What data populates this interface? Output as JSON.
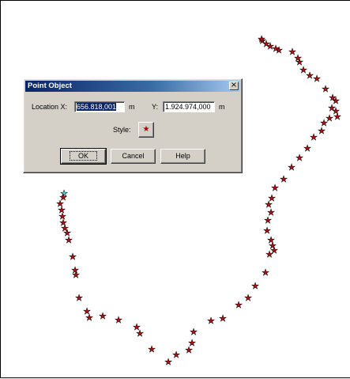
{
  "dialog": {
    "title": "Point Object",
    "close_glyph": "×",
    "location_x_label": "Location X:",
    "location_x_value": "656.818,001",
    "unit_m": "m",
    "y_label": "Y:",
    "y_value": "1.924.974,000",
    "style_label": "Style:",
    "style_icon": "star-symbol-icon",
    "buttons": {
      "ok": "OK",
      "cancel": "Cancel",
      "help": "Help"
    }
  },
  "map": {
    "symbol": "★",
    "symbol_color": "#b01010",
    "selected_symbol_color": "#5fd0e0",
    "point_count": 79
  },
  "colors": {
    "title_bar_start": "#0a246a",
    "title_bar_end": "#a6caf0",
    "dialog_face": "#d4d0c8"
  }
}
